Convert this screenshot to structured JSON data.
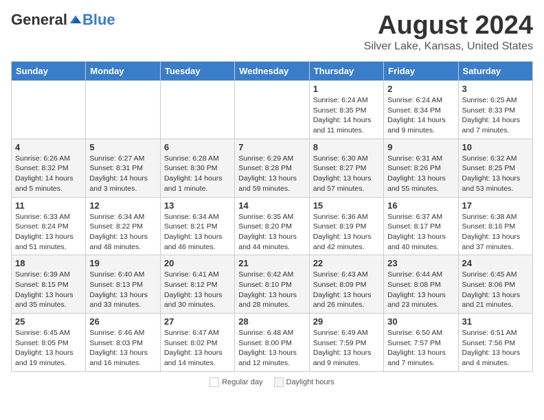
{
  "header": {
    "logo_general": "General",
    "logo_blue": "Blue",
    "month_title": "August 2024",
    "location": "Silver Lake, Kansas, United States"
  },
  "calendar": {
    "weekdays": [
      "Sunday",
      "Monday",
      "Tuesday",
      "Wednesday",
      "Thursday",
      "Friday",
      "Saturday"
    ],
    "weeks": [
      [
        {
          "day": "",
          "info": ""
        },
        {
          "day": "",
          "info": ""
        },
        {
          "day": "",
          "info": ""
        },
        {
          "day": "",
          "info": ""
        },
        {
          "day": "1",
          "info": "Sunrise: 6:24 AM\nSunset: 8:35 PM\nDaylight: 14 hours and 11 minutes."
        },
        {
          "day": "2",
          "info": "Sunrise: 6:24 AM\nSunset: 8:34 PM\nDaylight: 14 hours and 9 minutes."
        },
        {
          "day": "3",
          "info": "Sunrise: 6:25 AM\nSunset: 8:33 PM\nDaylight: 14 hours and 7 minutes."
        }
      ],
      [
        {
          "day": "4",
          "info": "Sunrise: 6:26 AM\nSunset: 8:32 PM\nDaylight: 14 hours and 5 minutes."
        },
        {
          "day": "5",
          "info": "Sunrise: 6:27 AM\nSunset: 8:31 PM\nDaylight: 14 hours and 3 minutes."
        },
        {
          "day": "6",
          "info": "Sunrise: 6:28 AM\nSunset: 8:30 PM\nDaylight: 14 hours and 1 minute."
        },
        {
          "day": "7",
          "info": "Sunrise: 6:29 AM\nSunset: 8:28 PM\nDaylight: 13 hours and 59 minutes."
        },
        {
          "day": "8",
          "info": "Sunrise: 6:30 AM\nSunset: 8:27 PM\nDaylight: 13 hours and 57 minutes."
        },
        {
          "day": "9",
          "info": "Sunrise: 6:31 AM\nSunset: 8:26 PM\nDaylight: 13 hours and 55 minutes."
        },
        {
          "day": "10",
          "info": "Sunrise: 6:32 AM\nSunset: 8:25 PM\nDaylight: 13 hours and 53 minutes."
        }
      ],
      [
        {
          "day": "11",
          "info": "Sunrise: 6:33 AM\nSunset: 8:24 PM\nDaylight: 13 hours and 51 minutes."
        },
        {
          "day": "12",
          "info": "Sunrise: 6:34 AM\nSunset: 8:22 PM\nDaylight: 13 hours and 48 minutes."
        },
        {
          "day": "13",
          "info": "Sunrise: 6:34 AM\nSunset: 8:21 PM\nDaylight: 13 hours and 46 minutes."
        },
        {
          "day": "14",
          "info": "Sunrise: 6:35 AM\nSunset: 8:20 PM\nDaylight: 13 hours and 44 minutes."
        },
        {
          "day": "15",
          "info": "Sunrise: 6:36 AM\nSunset: 8:19 PM\nDaylight: 13 hours and 42 minutes."
        },
        {
          "day": "16",
          "info": "Sunrise: 6:37 AM\nSunset: 8:17 PM\nDaylight: 13 hours and 40 minutes."
        },
        {
          "day": "17",
          "info": "Sunrise: 6:38 AM\nSunset: 8:16 PM\nDaylight: 13 hours and 37 minutes."
        }
      ],
      [
        {
          "day": "18",
          "info": "Sunrise: 6:39 AM\nSunset: 8:15 PM\nDaylight: 13 hours and 35 minutes."
        },
        {
          "day": "19",
          "info": "Sunrise: 6:40 AM\nSunset: 8:13 PM\nDaylight: 13 hours and 33 minutes."
        },
        {
          "day": "20",
          "info": "Sunrise: 6:41 AM\nSunset: 8:12 PM\nDaylight: 13 hours and 30 minutes."
        },
        {
          "day": "21",
          "info": "Sunrise: 6:42 AM\nSunset: 8:10 PM\nDaylight: 13 hours and 28 minutes."
        },
        {
          "day": "22",
          "info": "Sunrise: 6:43 AM\nSunset: 8:09 PM\nDaylight: 13 hours and 26 minutes."
        },
        {
          "day": "23",
          "info": "Sunrise: 6:44 AM\nSunset: 8:08 PM\nDaylight: 13 hours and 23 minutes."
        },
        {
          "day": "24",
          "info": "Sunrise: 6:45 AM\nSunset: 8:06 PM\nDaylight: 13 hours and 21 minutes."
        }
      ],
      [
        {
          "day": "25",
          "info": "Sunrise: 6:45 AM\nSunset: 8:05 PM\nDaylight: 13 hours and 19 minutes."
        },
        {
          "day": "26",
          "info": "Sunrise: 6:46 AM\nSunset: 8:03 PM\nDaylight: 13 hours and 16 minutes."
        },
        {
          "day": "27",
          "info": "Sunrise: 6:47 AM\nSunset: 8:02 PM\nDaylight: 13 hours and 14 minutes."
        },
        {
          "day": "28",
          "info": "Sunrise: 6:48 AM\nSunset: 8:00 PM\nDaylight: 13 hours and 12 minutes."
        },
        {
          "day": "29",
          "info": "Sunrise: 6:49 AM\nSunset: 7:59 PM\nDaylight: 13 hours and 9 minutes."
        },
        {
          "day": "30",
          "info": "Sunrise: 6:50 AM\nSunset: 7:57 PM\nDaylight: 13 hours and 7 minutes."
        },
        {
          "day": "31",
          "info": "Sunrise: 6:51 AM\nSunset: 7:56 PM\nDaylight: 13 hours and 4 minutes."
        }
      ]
    ]
  },
  "legend": {
    "white_label": "Regular day",
    "daylight_label": "Daylight hours"
  }
}
